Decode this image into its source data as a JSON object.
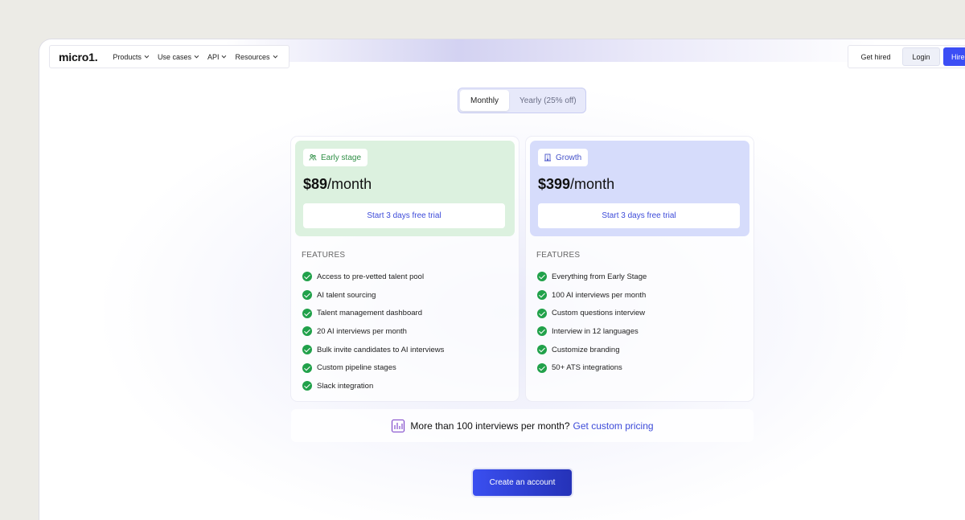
{
  "nav": {
    "logo": "micro1.",
    "items": [
      {
        "label": "Products"
      },
      {
        "label": "Use cases"
      },
      {
        "label": "API"
      },
      {
        "label": "Resources"
      }
    ],
    "get_hired": "Get hired",
    "login": "Login",
    "hire": "Hire"
  },
  "billing_toggle": {
    "selected": "Monthly",
    "other": "Yearly (25% off)"
  },
  "plans": [
    {
      "badge": "Early stage",
      "price": "$89",
      "period": "/month",
      "cta": "Start 3 days free trial",
      "features_label": "FEATURES",
      "features": [
        "Access to pre-vetted talent pool",
        "AI talent sourcing",
        "Talent management dashboard",
        "20 AI interviews per month",
        "Bulk invite candidates to AI interviews",
        "Custom pipeline stages",
        "Slack integration"
      ]
    },
    {
      "badge": "Growth",
      "price": "$399",
      "period": "/month",
      "cta": "Start 3 days free trial",
      "features_label": "FEATURES",
      "features": [
        "Everything from Early Stage",
        "100 AI interviews per month",
        "Custom questions interview",
        "Interview in 12 languages",
        "Customize branding",
        "50+ ATS integrations"
      ]
    }
  ],
  "custom_pricing": {
    "text": "More than 100 interviews per month?",
    "link": "Get custom pricing"
  },
  "create_account": "Create an account",
  "colors": {
    "accent": "#3c4ef5",
    "early_bg": "#dcf1df",
    "growth_bg": "#d6dcfb",
    "check": "#21a14a"
  }
}
